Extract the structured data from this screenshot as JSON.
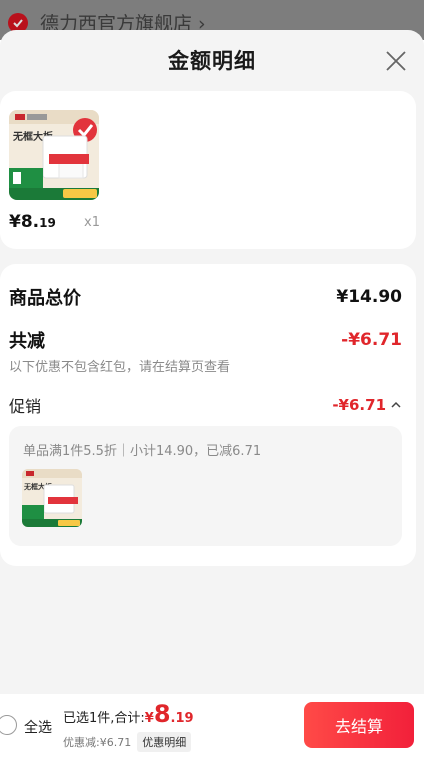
{
  "background": {
    "store_name": "德力西官方旗舰店 ›"
  },
  "sheet": {
    "title": "金额明细"
  },
  "product": {
    "image_caption": "无框大板",
    "price_int": "¥8.",
    "price_dec": "19",
    "quantity": "x1"
  },
  "summary": {
    "total_label": "商品总价",
    "total_value": "¥14.90",
    "discount_label": "共减",
    "discount_value": "-¥6.71",
    "discount_note": "以下优惠不包含红包，请在结算页查看",
    "promo_label": "促销",
    "promo_value": "-¥6.71",
    "promo_detail": "单品满1件5.5折｜小计14.90，已减6.71"
  },
  "bottom_bar": {
    "select_all": "全选",
    "summary_prefix": "已选1件,合计:",
    "total_currency": "¥",
    "total_int": "8",
    "total_dec": ".19",
    "discount_text": "优惠减:¥6.71",
    "detail_label": "优惠明细",
    "checkout_label": "去结算"
  },
  "colors": {
    "accent": "#e0262b",
    "checkout_start": "#ff4a47",
    "checkout_end": "#f2203a"
  }
}
